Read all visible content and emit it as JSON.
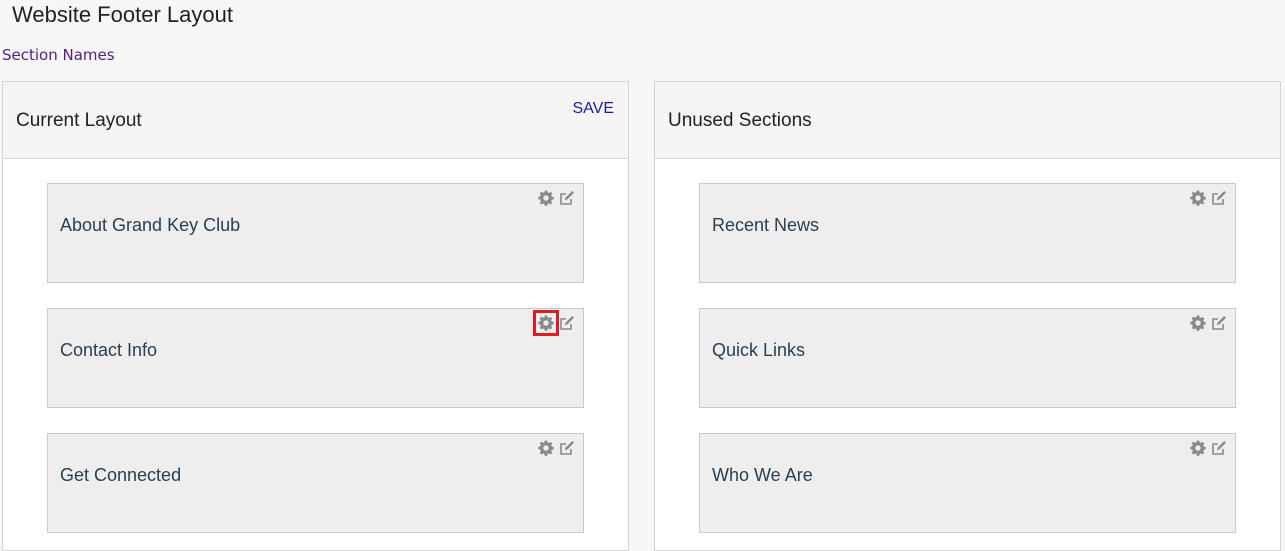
{
  "page": {
    "title": "Website Footer Layout"
  },
  "nav": {
    "section_names_link": "Section Names"
  },
  "current_layout": {
    "title": "Current Layout",
    "save_label": "SAVE",
    "sections": [
      {
        "label": "About Grand Key Club"
      },
      {
        "label": "Contact Info"
      },
      {
        "label": "Get Connected"
      }
    ]
  },
  "unused_sections": {
    "title": "Unused Sections",
    "sections": [
      {
        "label": "Recent News"
      },
      {
        "label": "Quick Links"
      },
      {
        "label": "Who We Are"
      }
    ]
  },
  "icons": {
    "settings": "gear-icon",
    "edit": "edit-icon"
  },
  "colors": {
    "highlight": "#e11b22",
    "link_visited": "#5b1a8a",
    "save_link": "#1a1aa6",
    "icon_gray": "#8a8a8a"
  }
}
